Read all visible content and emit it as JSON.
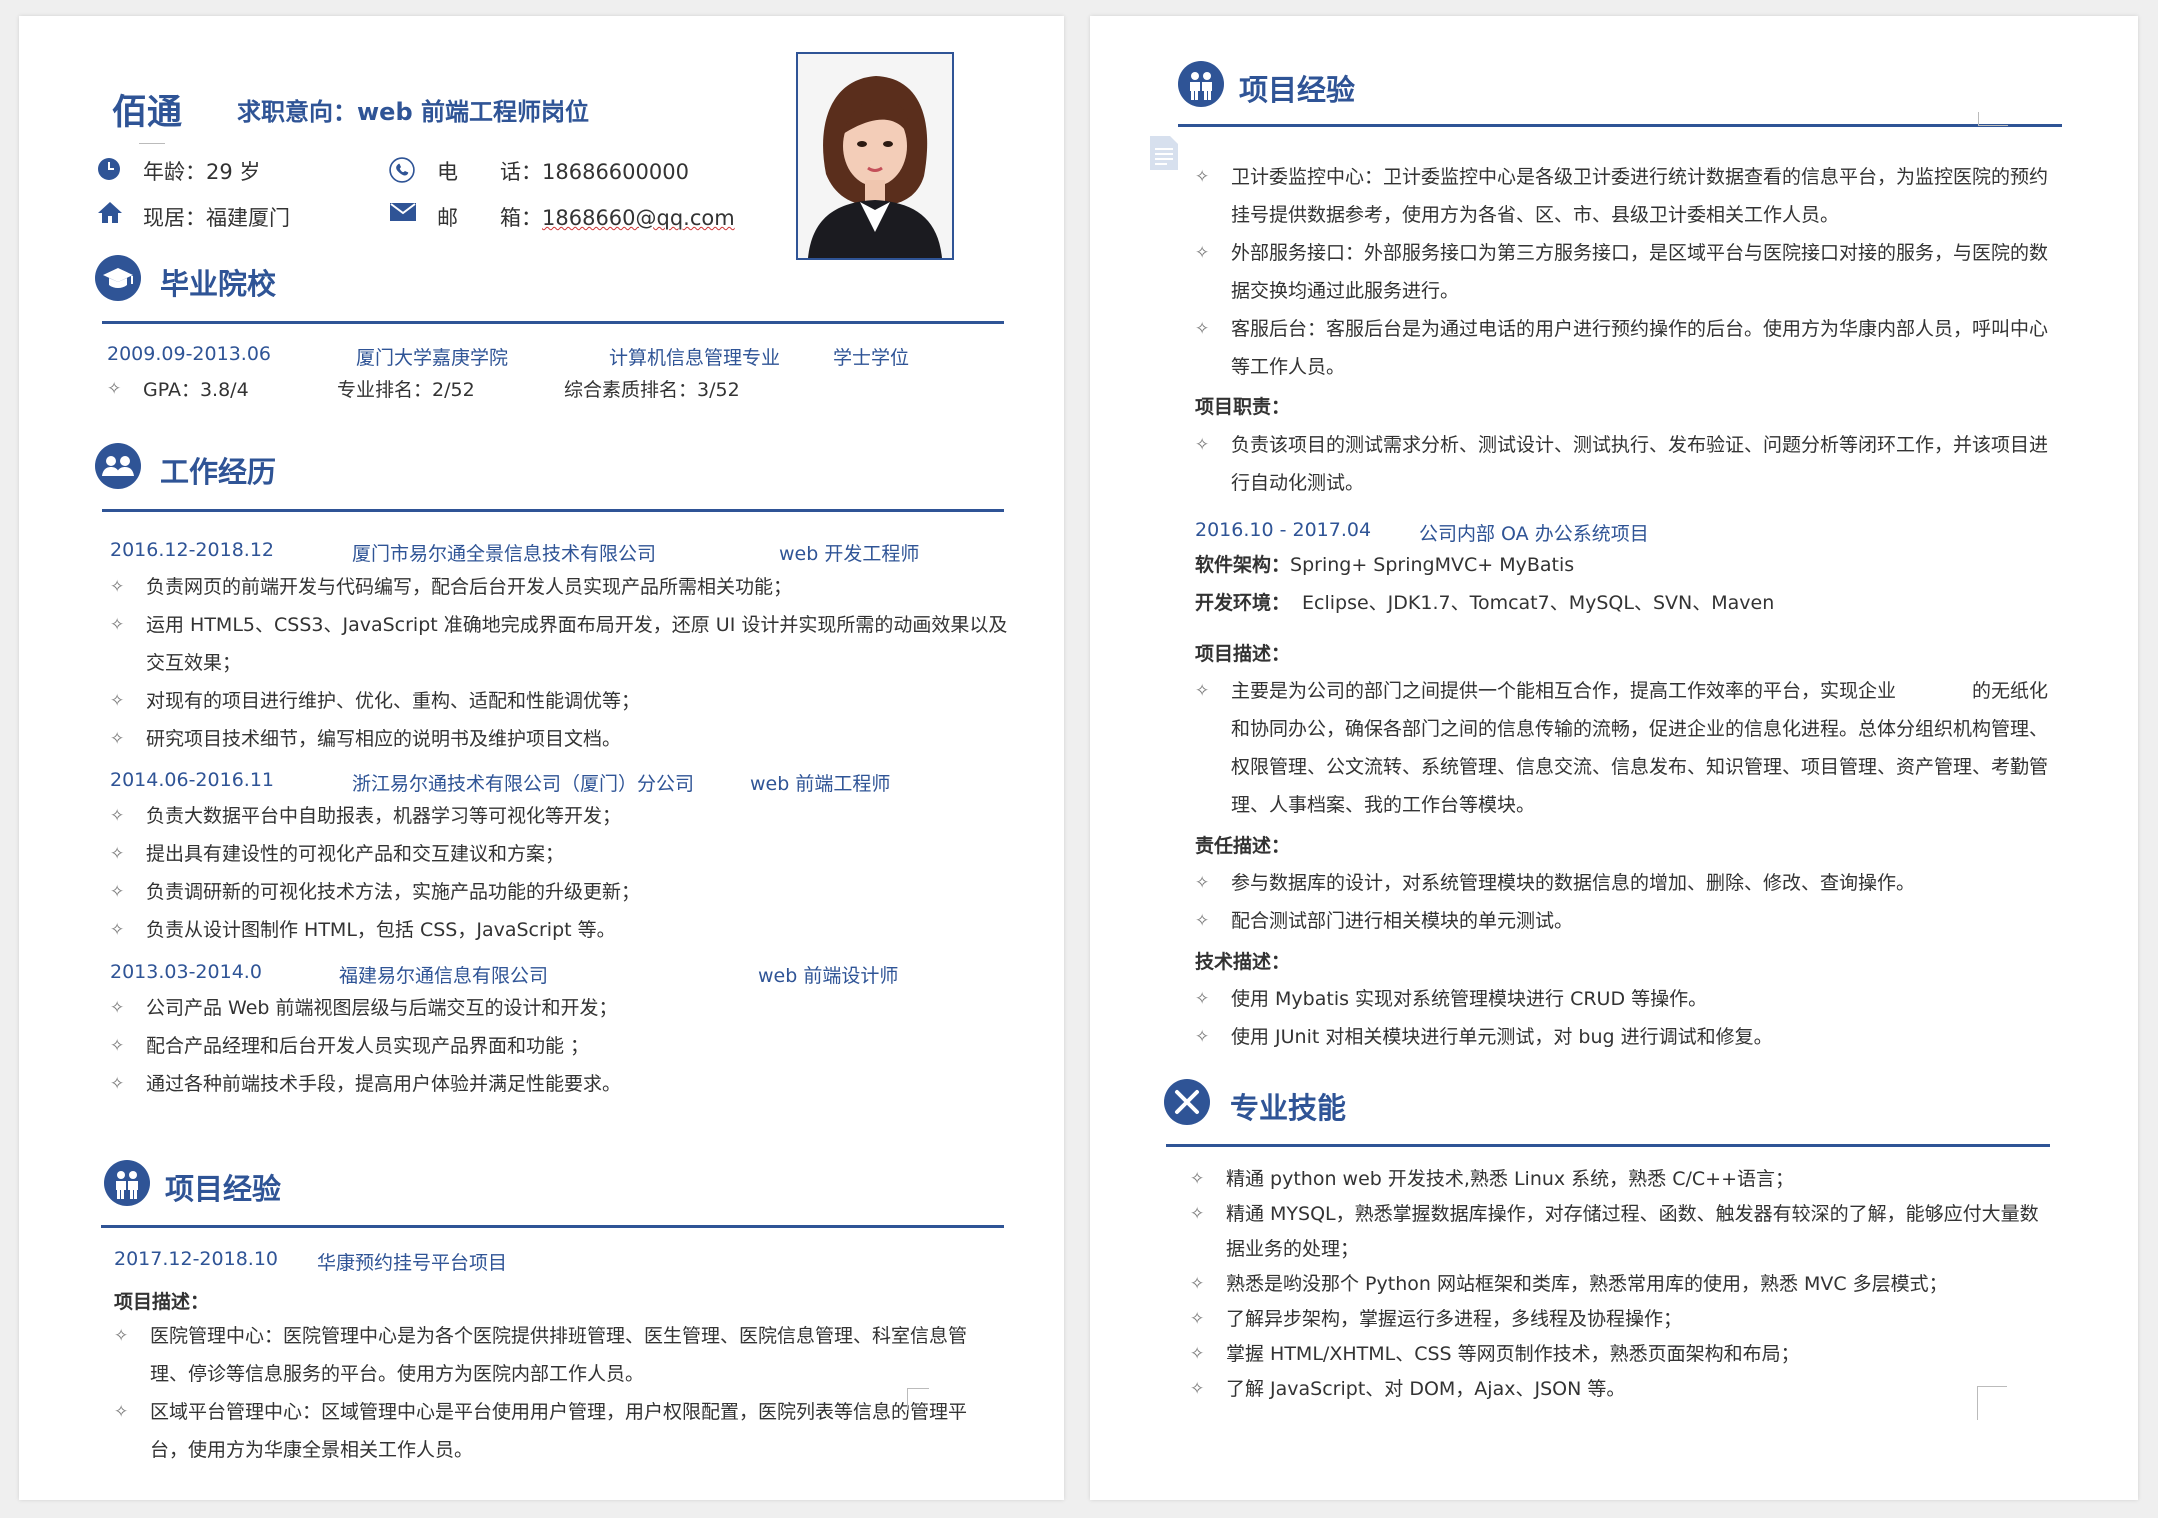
{
  "header": {
    "name": "佰通",
    "intent": "求职意向：web 前端工程师岗位",
    "age_label": "年龄：",
    "age_value": "29 岁",
    "phone_label": "电　　话：",
    "phone_value": "18686600000",
    "residence_label": "现居：",
    "residence_value": "福建厦门",
    "email_label": "邮　　箱：",
    "email_value": "1868660@qq.com"
  },
  "education": {
    "title": "毕业院校",
    "period": "2009.09-2013.06",
    "school": "厦门大学嘉庚学院",
    "major": "计算机信息管理专业",
    "degree": "学士学位",
    "gpa": "GPA：3.8/4",
    "major_rank": "专业排名：2/52",
    "overall_rank": "综合素质排名：3/52"
  },
  "work": {
    "title": "工作经历",
    "jobs": [
      {
        "period": "2016.12-2018.12",
        "company": "厦门市易尔通全景信息技术有限公司",
        "role": "web 开发工程师",
        "bullets": [
          "负责网页的前端开发与代码编写，配合后台开发人员实现产品所需相关功能；",
          "运用 HTML5、CSS3、JavaScript 准确地完成界面布局开发，还原 UI 设计并实现所需的动画效果以及交互效果；",
          "对现有的项目进行维护、优化、重构、适配和性能调优等；",
          "研究项目技术细节，编写相应的说明书及维护项目文档。"
        ]
      },
      {
        "period": "2014.06-2016.11",
        "company": "浙江易尔通技术有限公司（厦门）分公司",
        "role": "web 前端工程师",
        "bullets": [
          "负责大数据平台中自助报表，机器学习等可视化等开发；",
          "提出具有建设性的可视化产品和交互建议和方案；",
          "负责调研新的可视化技术方法，实施产品功能的升级更新；",
          "负责从设计图制作 HTML，包括 CSS，JavaScript 等。"
        ]
      },
      {
        "period": "2013.03-2014.0",
        "company": "福建易尔通信息有限公司",
        "role": "web 前端设计师",
        "bullets": [
          "公司产品 Web 前端视图层级与后端交互的设计和开发；",
          "配合产品经理和后台开发人员实现产品界面和功能 ；",
          "通过各种前端技术手段，提高用户体验并满足性能要求。"
        ]
      }
    ]
  },
  "projects": {
    "title": "项目经验",
    "p1": {
      "period": "2017.12-2018.10",
      "name": "华康预约挂号平台项目",
      "desc_label": "项目描述：",
      "bullets": [
        "医院管理中心：医院管理中心是为各个医院提供排班管理、医生管理、医院信息管理、科室信息管理、停诊等信息服务的平台。使用方为医院内部工作人员。",
        "区域平台管理中心：区域管理中心是平台使用用户管理，用户权限配置，医院列表等信息的管理平台，使用方为华康全景相关工作人员。"
      ]
    },
    "p1_cont": [
      "卫计委监控中心：卫计委监控中心是各级卫计委进行统计数据查看的信息平台，为监控医院的预约挂号提供数据参考，使用方为各省、区、市、县级卫计委相关工作人员。",
      "外部服务接口：外部服务接口为第三方服务接口，是区域平台与医院接口对接的服务，与医院的数据交换均通过此服务进行。",
      "客服后台：客服后台是为通过电话的用户进行预约操作的后台。使用方为华康内部人员，呼叫中心等工作人员。"
    ],
    "p1_duty_label": "项目职责：",
    "p1_duty": [
      "负责该项目的测试需求分析、测试设计、测试执行、发布验证、问题分析等闭环工作，并该项目进行自动化测试。"
    ],
    "p2": {
      "period": "2016.10 - 2017.04",
      "name": "公司内部 OA 办公系统项目",
      "arch_label": "软件架构：",
      "arch": "Spring+ SpringMVC+ MyBatis",
      "env_label": "开发环境：",
      "env": "Eclipse、JDK1.7、Tomcat7、MySQL、SVN、Maven",
      "desc_label": "项目描述：",
      "desc": [
        "主要是为公司的部门之间提供一个能相互合作，提高工作效率的平台，实现企业　　　　的无纸化和协同办公，确保各部门之间的信息传输的流畅，促进企业的信息化进程。总体分组织机构管理、权限管理、公文流转、系统管理、信息交流、信息发布、知识管理、项目管理、资产管理、考勤管理、人事档案、我的工作台等模块。"
      ],
      "duty_label": "责任描述：",
      "duty": [
        "参与数据库的设计，对系统管理模块的数据信息的增加、删除、修改、查询操作。",
        "配合测试部门进行相关模块的单元测试。"
      ],
      "tech_label": "技术描述：",
      "tech": [
        "使用 Mybatis 实现对系统管理模块进行 CRUD 等操作。",
        "使用 JUnit 对相关模块进行单元测试，对 bug 进行调试和修复。"
      ]
    }
  },
  "skills": {
    "title": "专业技能",
    "items": [
      "精通 python web 开发技术,熟悉 Linux 系统，熟悉 C/C++语言；",
      "精通 MYSQL，熟悉掌握数据库操作，对存储过程、函数、触发器有较深的了解，能够应付大量数据业务的处理；",
      "熟悉是哟没那个 Python 网站框架和类库，熟悉常用库的使用，熟悉 MVC 多层模式；",
      "了解异步架构，掌握运行多进程，多线程及协程操作；",
      "掌握 HTML/XHTML、CSS 等网页制作技术，熟悉页面架构和布局；",
      "了解 JavaScript、对 DOM，Ajax、JSON 等。"
    ]
  },
  "colors": {
    "accent": "#2f5496",
    "text": "#333333",
    "page": "#ffffff",
    "background": "#efefef"
  }
}
